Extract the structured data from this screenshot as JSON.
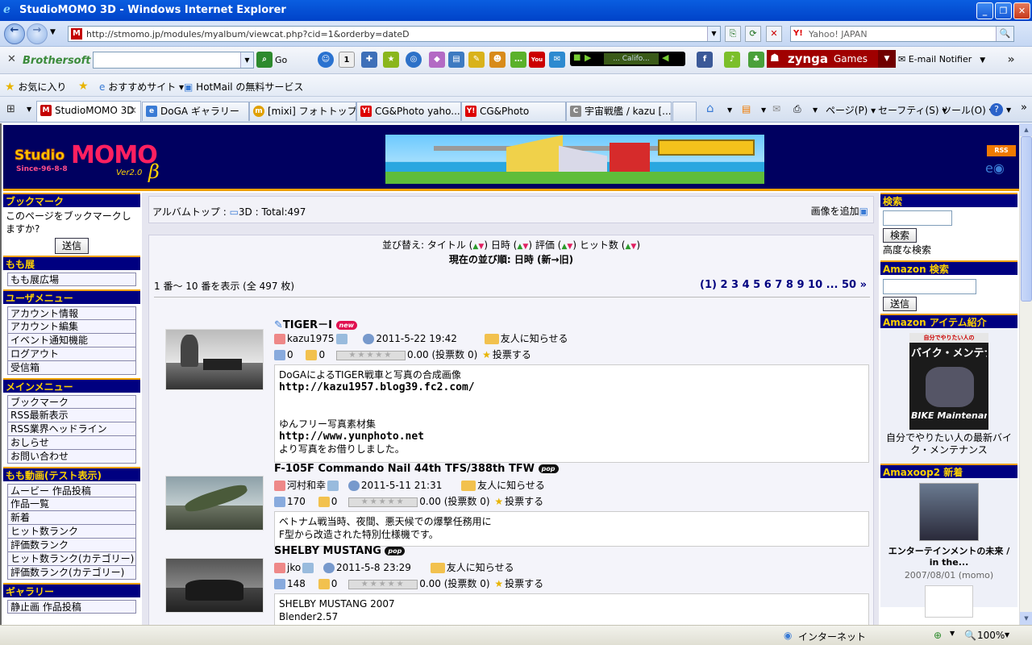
{
  "window": {
    "title": "StudioMOMO 3D - Windows Internet Explorer",
    "url": "http://stmomo.jp/modules/myalbum/viewcat.php?cid=1&orderby=dateD",
    "yahoo_placeholder": "Yahoo! JAPAN",
    "toolbar_brand": "Brothersoft",
    "go_label": "Go",
    "player_label": "... Califo...",
    "zynga_label": "zynga",
    "games_label": "Games",
    "email_notifier": "E-mail Notifier",
    "fav_label": "お気に入り",
    "fav_links": [
      "おすすめサイト ▾",
      "HotMail の無料サービス"
    ],
    "tabs": [
      "StudioMOMO 3D",
      "DoGA ギャラリー",
      "[mixi] フォトトップ",
      "CG&Photo yaho...",
      "CG&Photo",
      "宇宙戦艦 / kazu [..."
    ],
    "commands": [
      "ページ(P) ▾",
      "セーフティ(S) ▾",
      "ツール(O) ▾"
    ],
    "status_zone": "インターネット",
    "zoom": "100%"
  },
  "site": {
    "logo_studio": "Studio",
    "logo_momo": "MOMO",
    "logo_since": "Since-96-8-8",
    "logo_ver": "Ver2.0",
    "logo_beta": "β",
    "rss": "RSS"
  },
  "left": {
    "bookmark_head": "ブックマーク",
    "bookmark_text": "このページをブックマークしますか?",
    "bookmark_btn": "送信",
    "momoten_head": "もも展",
    "momoten_items": [
      "もも展広場"
    ],
    "user_head": "ユーザメニュー",
    "user_items": [
      "アカウント情報",
      "アカウント編集",
      "イベント通知機能",
      "ログアウト",
      "受信箱"
    ],
    "main_head": "メインメニュー",
    "main_items": [
      "ブックマーク",
      "RSS最新表示",
      "RSS業界ヘッドライン",
      "おしらせ",
      "お問い合わせ"
    ],
    "movie_head": "もも動画(テスト表示)",
    "movie_items": [
      "ムービー 作品投稿",
      "作品一覧",
      "新着",
      "ヒット数ランク",
      "評価数ランク",
      "ヒット数ランク(カテゴリー)",
      "評価数ランク(カテゴリー)"
    ],
    "gallery_head": "ギャラリー",
    "gallery_items": [
      "静止画 作品投稿"
    ]
  },
  "center": {
    "album_top": "アルバムトップ",
    "category": "3D",
    "total": "Total:497",
    "add_image": "画像を追加",
    "sort_label": "並び替え:",
    "sort_keys": [
      "タイトル",
      "日時",
      "評価",
      "ヒット数"
    ],
    "current_order": "現在の並び順: 日時 (新→旧)",
    "range": "1 番～ 10 番を表示 (全 497 枚)",
    "pager": "(1) 2 3 4 5 6 7 8 9 10 ... 50 »",
    "entries": [
      {
        "title": "TIGER－Ⅰ",
        "badge": "new",
        "user": "kazu1975",
        "date": "2011-5-22 19:42",
        "tell": "友人に知らせる",
        "hits": "0",
        "comments": "0",
        "score": "0.00 (投票数 0)",
        "vote": "投票する",
        "desc_lines": [
          "DoGAによるTIGER戦車と写真の合成画像"
        ],
        "url1": "http://kazu1957.blog39.fc2.com/",
        "desc2": "ゆんフリー写真素材集",
        "url2": "http://www.yunphoto.net",
        "desc3": "より写真をお借りしました。"
      },
      {
        "title": "F-105F Commando Nail  44th TFS/388th TFW",
        "badge": "pop",
        "user": "河村和幸",
        "date": "2011-5-11 21:31",
        "tell": "友人に知らせる",
        "hits": "170",
        "comments": "0",
        "score": "0.00 (投票数 0)",
        "vote": "投票する",
        "desc": "ベトナム戦当時、夜間、悪天候での爆撃任務用に\nF型から改造された特別仕様機です。"
      },
      {
        "title": "SHELBY MUSTANG",
        "badge": "pop",
        "user": "jko",
        "date": "2011-5-8 23:29",
        "tell": "友人に知らせる",
        "hits": "148",
        "comments": "0",
        "score": "0.00 (投票数 0)",
        "vote": "投票する",
        "desc": "SHELBY MUSTANG 2007\nBlender2.57"
      }
    ]
  },
  "right": {
    "search_head": "検索",
    "search_btn": "検索",
    "advanced": "高度な検索",
    "amazon_head": "Amazon 検索",
    "amazon_btn": "送信",
    "item_head": "Amazon アイテム紹介",
    "item_caption": "自分でやりたい人の最新バイク・メンテナンス",
    "book_title_top": "自分でやりたい人の",
    "book_title_main": "バイク・メンテナンス",
    "book_title_en": "BIKE Maintenance",
    "amaxoop_head": "Amaxoop2 新着",
    "amaxoop_item": "エンターテインメントの未来 / in the...",
    "amaxoop_date": "2007/08/01 (momo)"
  }
}
